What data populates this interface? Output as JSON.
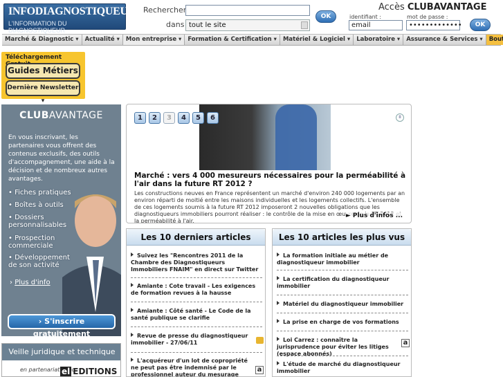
{
  "header": {
    "logo_line1": "INFODIAGNOSTIQUEUR.COM",
    "logo_line2": "L'INFORMATION DU DIAGNOSTIQUEUR",
    "search_label": "Rechercher",
    "scope_label": "dans",
    "scope_value": "tout le site",
    "ok_label": "OK",
    "club_prefix": "Accès ",
    "club_name": "CLUBAVANTAGE",
    "id_label": "identifiant :",
    "pwd_label": "mot de passe :",
    "id_value": "email",
    "pwd_value": "•••••••••••••"
  },
  "nav": [
    {
      "label": "Marché & Diagnostic ▾",
      "name": "nav-marche-diagnostic"
    },
    {
      "label": "Actualité ▾",
      "name": "nav-actualite"
    },
    {
      "label": "Mon entreprise ▾",
      "name": "nav-mon-entreprise"
    },
    {
      "label": "Formation & Certification ▾",
      "name": "nav-formation"
    },
    {
      "label": "Matériel & Logiciel ▾",
      "name": "nav-materiel"
    },
    {
      "label": "Laboratoire ▾",
      "name": "nav-laboratoire"
    },
    {
      "label": "Assurance & Services ▾",
      "name": "nav-assurance"
    },
    {
      "label": "Boutique ▾",
      "name": "nav-boutique"
    }
  ],
  "download": {
    "title": "Téléchargement Gratuit",
    "guides": "Guides Métiers ▾",
    "newsletter": "Dernière Newsletter ▾"
  },
  "club": {
    "title_bold": "CLUB",
    "title_rest": "AVANTAGE",
    "intro": "En vous inscrivant, les partenaires vous offrent des contenus exclusifs, des outils d'accompagnement, une aide à la décision et de nombreux autres avantages.",
    "features": [
      "• Fiches pratiques",
      "• Boîtes à outils",
      "• Dossiers personnalisables",
      "• Prospection commerciale",
      "• Développement de son activité"
    ],
    "more": "Plus d'info",
    "register": "› S'inscrire gratuitement"
  },
  "veille": {
    "title": "Veille juridique et technique",
    "partner": "en partenariat avec",
    "editions": "EDITIONS"
  },
  "slideshow": {
    "numbers": [
      "1",
      "2",
      "3",
      "4",
      "5",
      "6"
    ],
    "active_index": 3,
    "pause": "II",
    "title": "Marché : vers 4 000 mesureurs nécessaires pour la perméabilité à l'air dans la future RT 2012 ?",
    "text": "Les constructions neuves en France représentent un marché d'environ 240 000 logements par an environ réparti de moitié entre les maisons individuelles et les logements collectifs. L'ensemble de ces logements soumis à la future RT 2012 imposeront 2 nouvelles obligations que les diagnostiqueurs immobiliers pourront réaliser : le contrôle de la mise en œuvre de la RT 2012 et la perméabilité à l'air.",
    "more": "Plus d'infos ..."
  },
  "latest": {
    "title": "Les 10 derniers articles",
    "items": [
      "Suivez les \"Rencontres 2011 de la Chambre des Diagnostiqueurs Immobiliers FNAIM\" en direct sur Twitter",
      "Amiante : Cote travail - Les exigences de formation revues à la hausse",
      "Amiante : Côté santé - Le Code de la santé publique se clarifie",
      "Revue de presse du diagnostiqueur immobilier - 27/06/11",
      "L'acquéreur d'un lot de copropriété ne peut pas être indemnisé par le professionnel auteur du mesurage erroné"
    ]
  },
  "popular": {
    "title": "Les 10 articles les plus vus",
    "items": [
      "La formation initiale au métier de diagnostiqueur immobilier",
      "La certification du diagnostiqueur immobilier",
      "Matériel du diagnostiqueur immobilier",
      "La prise en charge de vos formations",
      "Loi Carrez : connaître la jurisprudence pour éviter les litiges (espace abonnés)",
      "L'étude de marché du diagnostiqueur immobilier"
    ],
    "badge": "a"
  },
  "colors": {
    "accent": "#2f6fb5",
    "club_bg": "#6f8190",
    "download_bg": "#f7c52e"
  }
}
